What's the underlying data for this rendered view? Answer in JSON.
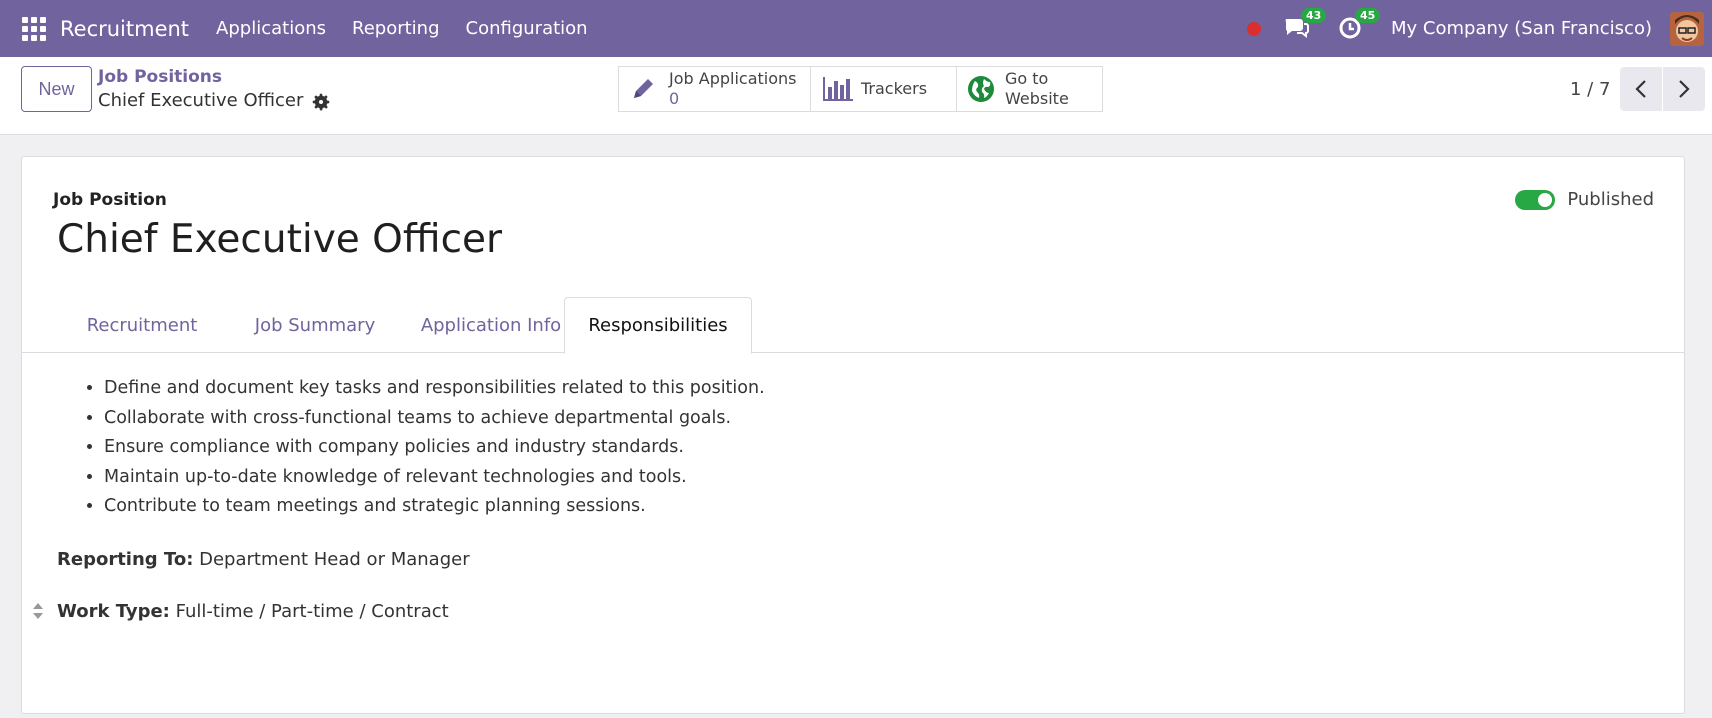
{
  "navbar": {
    "app_name": "Recruitment",
    "menu": [
      "Applications",
      "Reporting",
      "Configuration"
    ],
    "messages_count": "43",
    "activities_count": "45",
    "company": "My Company (San Francisco)"
  },
  "control_panel": {
    "new_label": "New",
    "breadcrumb_parent": "Job Positions",
    "breadcrumb_current": "Chief Executive Officer",
    "smart_buttons": {
      "job_applications_label": "Job Applications",
      "job_applications_count": "0",
      "trackers_label": "Trackers",
      "website_line1": "Go to",
      "website_line2": "Website"
    },
    "pager": "1 / 7"
  },
  "form": {
    "field_label": "Job Position",
    "record_name": "Chief Executive Officer",
    "published_label": "Published",
    "tabs": [
      "Recruitment",
      "Job Summary",
      "Application Info",
      "Responsibilities"
    ],
    "active_tab": "Responsibilities",
    "responsibilities": [
      "Define and document key tasks and responsibilities related to this position.",
      "Collaborate with cross-functional teams to achieve departmental goals.",
      "Ensure compliance with company policies and industry standards.",
      "Maintain up-to-date knowledge of relevant technologies and tools.",
      "Contribute to team meetings and strategic planning sessions."
    ],
    "reporting_to_label": "Reporting To:",
    "reporting_to_value": "Department Head or Manager",
    "work_type_label": "Work Type:",
    "work_type_value": "Full-time / Part-time / Contract"
  },
  "colors": {
    "brand": "#71639e",
    "success": "#28a745",
    "recording": "#d9302f"
  },
  "icons": [
    "apps-grid-icon",
    "recording-dot-icon",
    "messages-icon",
    "activities-clock-icon",
    "gear-icon",
    "pencil-icon",
    "bar-chart-icon",
    "globe-icon",
    "chevron-left-icon",
    "chevron-right-icon",
    "drag-handle-icon"
  ]
}
